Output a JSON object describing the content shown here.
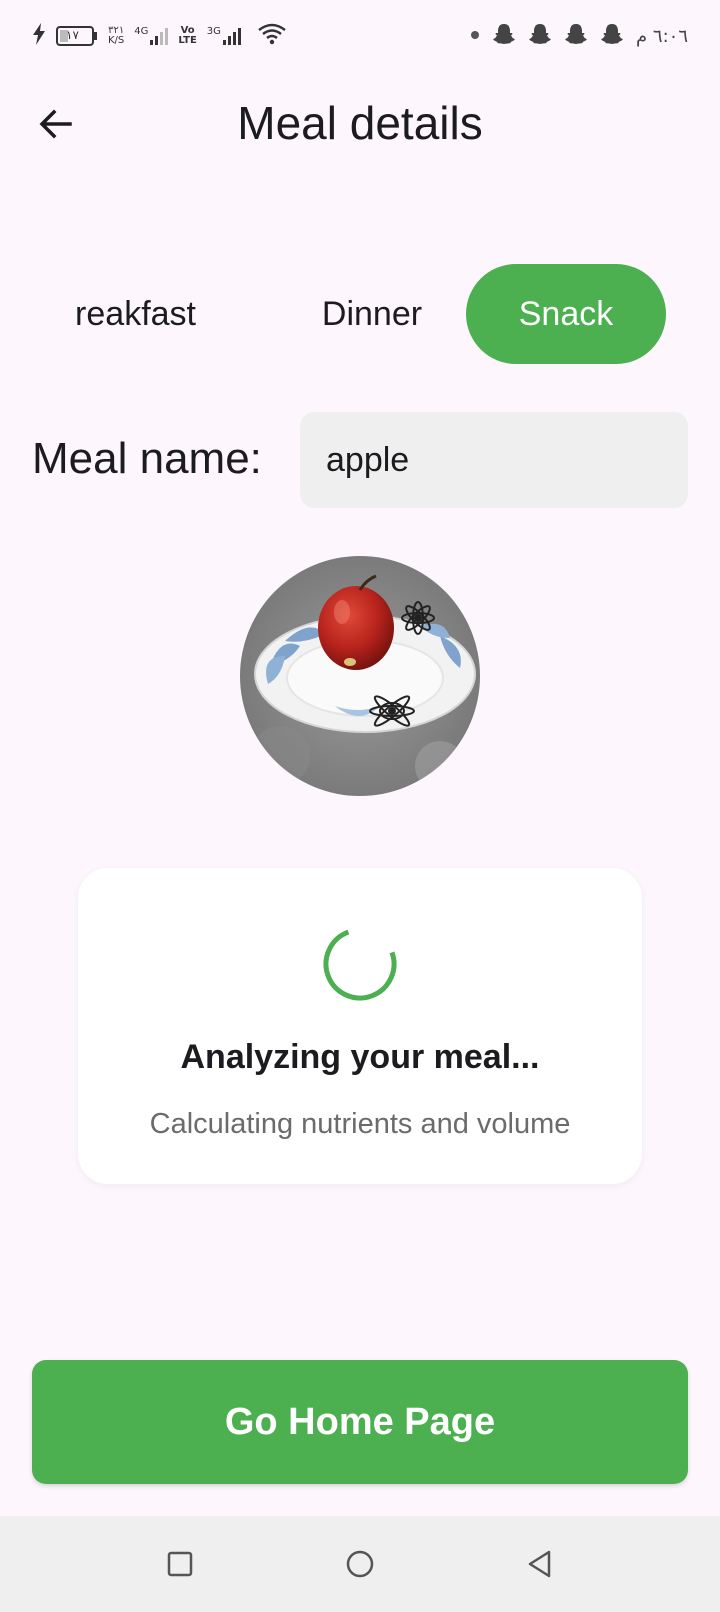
{
  "status_bar": {
    "battery_level": "١٧",
    "data_speed_value": "٣٢١",
    "data_speed_unit": "K/S",
    "network_1": "4G",
    "volte_top": "Vo",
    "volte_bottom": "LTE",
    "network_2": "3G",
    "time": "٦:٠٦ م",
    "icons": [
      "charging-bolt-icon",
      "battery-icon",
      "signal-icon",
      "wifi-icon",
      "notification-dot-icon",
      "snapchat-icon"
    ]
  },
  "app_bar": {
    "title": "Meal details",
    "back_icon": "arrow-left-icon"
  },
  "meal_types": {
    "items": [
      "reakfast",
      "Dinner",
      "Snack"
    ],
    "selected": "Snack",
    "accent_color": "#4CAF50"
  },
  "meal_name": {
    "label": "Meal name:",
    "value": "apple"
  },
  "analysis": {
    "title": "Analyzing your meal...",
    "subtitle": "Calculating nutrients and volume"
  },
  "actions": {
    "home_label": "Go Home Page"
  },
  "nav_bar": {
    "icons": [
      "recents-square-icon",
      "home-circle-icon",
      "back-triangle-icon"
    ]
  }
}
